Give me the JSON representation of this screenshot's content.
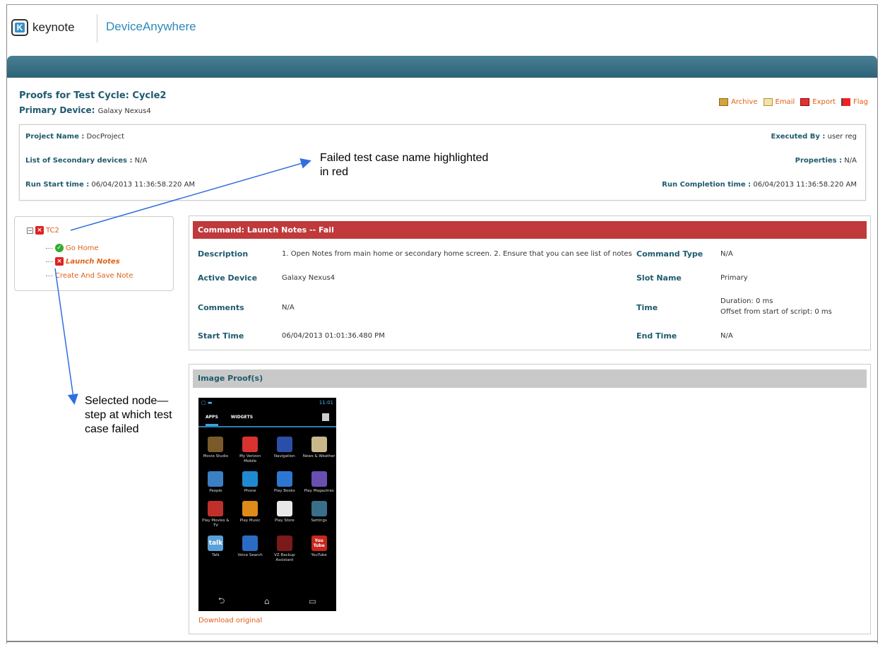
{
  "header": {
    "keynote_logo_text": "keynote",
    "product_name": "DeviceAnywhere"
  },
  "page": {
    "title_label": "Proofs for Test Cycle:",
    "title_value": "Cycle2",
    "primary_device_label": "Primary Device:",
    "primary_device_value": "Galaxy Nexus4"
  },
  "actions": {
    "archive": "Archive",
    "email": "Email",
    "export": "Export",
    "flag": "Flag"
  },
  "info": {
    "project_name_label": "Project Name :",
    "project_name_value": "DocProject",
    "secondary_label": "List of Secondary devices :",
    "secondary_value": "N/A",
    "run_start_label": "Run Start time :",
    "run_start_value": "06/04/2013 11:36:58.220 AM",
    "executed_by_label": "Executed By :",
    "executed_by_value": "user reg",
    "properties_label": "Properties :",
    "properties_value": "N/A",
    "run_completion_label": "Run Completion time :",
    "run_completion_value": "06/04/2013 11:36:58.220 AM"
  },
  "tree": {
    "root": "TC2",
    "collapse_toggle": "−",
    "children": [
      "Go Home",
      "Launch Notes",
      "Create And Save Note"
    ]
  },
  "command": {
    "header": "Command: Launch Notes -- Fail",
    "description_label": "Description",
    "description_value": "1. Open Notes from main home or secondary home screen. 2. Ensure that you can see list of notes",
    "active_device_label": "Active Device",
    "active_device_value": "Galaxy Nexus4",
    "comments_label": "Comments",
    "comments_value": "N/A",
    "start_time_label": "Start Time",
    "start_time_value": "06/04/2013 01:01:36.480 PM",
    "command_type_label": "Command Type",
    "command_type_value": "N/A",
    "slot_name_label": "Slot Name",
    "slot_name_value": "Primary",
    "time_label": "Time",
    "time_duration": "Duration: 0 ms",
    "time_offset": "Offset from start of script: 0 ms",
    "end_time_label": "End Time",
    "end_time_value": "N/A"
  },
  "image_proof": {
    "header": "Image Proof(s)",
    "download_link": "Download original",
    "phone": {
      "clock": "11:01",
      "tab_apps": "APPS",
      "tab_widgets": "WIDGETS",
      "apps": [
        {
          "label": "Movie Studio",
          "color": "#7a5a2a"
        },
        {
          "label": "My Verizon Mobile",
          "color": "#d8332f"
        },
        {
          "label": "Navigation",
          "color": "#2b4fa8"
        },
        {
          "label": "News & Weather",
          "color": "#c9b98a"
        },
        {
          "label": "People",
          "color": "#3b7fc4"
        },
        {
          "label": "Phone",
          "color": "#1f8ad0"
        },
        {
          "label": "Play Books",
          "color": "#2d77d0"
        },
        {
          "label": "Play Magazines",
          "color": "#6b4fb0"
        },
        {
          "label": "Play Movies & TV",
          "color": "#c0302a"
        },
        {
          "label": "Play Music",
          "color": "#e08a1a"
        },
        {
          "label": "Play Store",
          "color": "#e8e8e8"
        },
        {
          "label": "Settings",
          "color": "#3a6f8a"
        },
        {
          "label": "Talk",
          "color": "#5aa0d8"
        },
        {
          "label": "Voice Search",
          "color": "#2a6cc4"
        },
        {
          "label": "VZ Backup Assistant",
          "color": "#7a1a1a"
        },
        {
          "label": "YouTube",
          "color": "#c8261e"
        }
      ],
      "talk_icon_text": "talk",
      "youtube_icon_text": "You Tube"
    }
  },
  "annotations": {
    "failed_note": "Failed test case name highlighted in red",
    "selected_note": "Selected node—step at which test case failed"
  }
}
